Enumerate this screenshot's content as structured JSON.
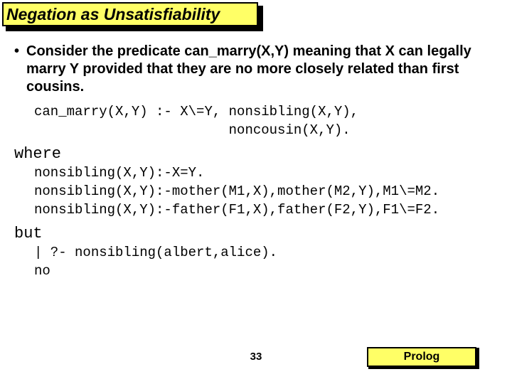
{
  "title": "Negation as Unsatisfiability",
  "bullet": "•",
  "intro": "Consider the predicate can_marry(X,Y) meaning that X can legally marry Y provided that they are no more closely related than first cousins.",
  "code1_l1": "can_marry(X,Y) :- X\\=Y, nonsibling(X,Y),",
  "code1_l2": "                        noncousin(X,Y).",
  "where": "where",
  "code2_l1": "nonsibling(X,Y):-X=Y.",
  "code2_l2": "nonsibling(X,Y):-mother(M1,X),mother(M2,Y),M1\\=M2.",
  "code2_l3": "nonsibling(X,Y):-father(F1,X),father(F2,Y),F1\\=F2.",
  "but": "but",
  "code3_l1": "| ?- nonsibling(albert,alice).",
  "code3_l2": "no",
  "page": "33",
  "tag": "Prolog"
}
